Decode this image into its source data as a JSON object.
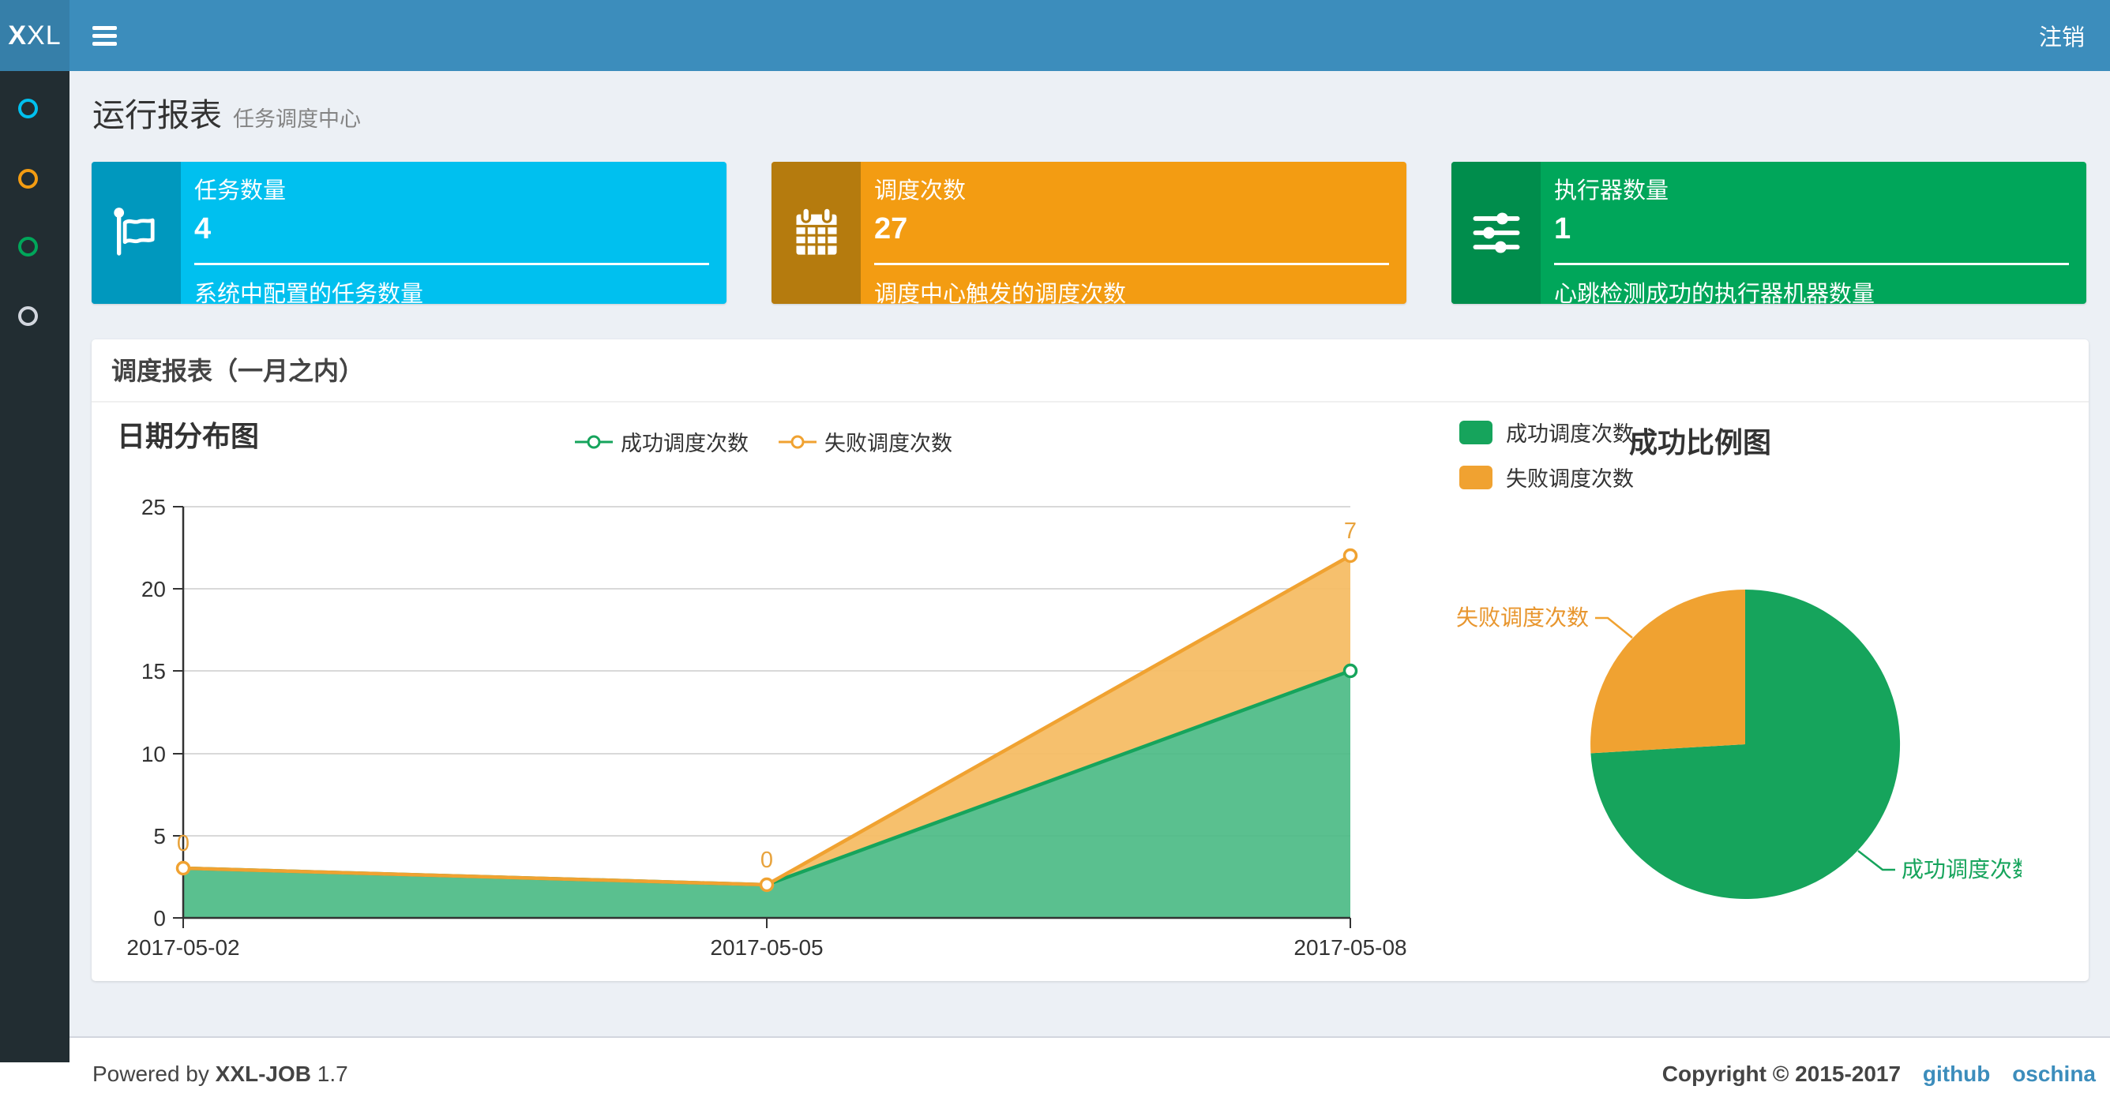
{
  "navbar": {
    "logo_bold": "X",
    "logo_rest": "XL",
    "logout_label": "注销"
  },
  "sidebar": {
    "items": [
      {
        "name": "running-report",
        "color": "#00c0ef"
      },
      {
        "name": "job-manage",
        "color": "#f39c12"
      },
      {
        "name": "executor-manage",
        "color": "#00a65a"
      },
      {
        "name": "help",
        "color": "#d2d6de"
      }
    ]
  },
  "page_header": {
    "title": "运行报表",
    "subtitle": "任务调度中心"
  },
  "info_boxes": [
    {
      "title": "任务数量",
      "value": "4",
      "description": "系统中配置的任务数量",
      "icon": "flag-icon",
      "color": "#00c0ef"
    },
    {
      "title": "调度次数",
      "value": "27",
      "description": "调度中心触发的调度次数",
      "icon": "calendar-icon",
      "color": "#f39c12"
    },
    {
      "title": "执行器数量",
      "value": "1",
      "description": "心跳检测成功的执行器机器数量",
      "icon": "sliders-icon",
      "color": "#00a65a"
    }
  ],
  "panel": {
    "title": "调度报表（一月之内）"
  },
  "line_chart": {
    "title": "日期分布图",
    "legend": [
      {
        "label": "成功调度次数",
        "color": "#16a45c"
      },
      {
        "label": "失败调度次数",
        "color": "#f0a231"
      }
    ],
    "y_ticks": [
      "25",
      "20",
      "15",
      "10",
      "5",
      "0"
    ],
    "x_labels": [
      "2017-05-02",
      "2017-05-05",
      "2017-05-08"
    ],
    "point_labels": [
      "0",
      "0",
      "7"
    ]
  },
  "pie_chart": {
    "title": "成功比例图",
    "legend": [
      {
        "label": "成功调度次数",
        "color": "#16a45c"
      },
      {
        "label": "失败调度次数",
        "color": "#f0a231"
      }
    ],
    "callout_fail": "失败调度次数",
    "callout_success": "成功调度次数"
  },
  "chart_data": [
    {
      "type": "area",
      "title": "日期分布图",
      "x": [
        "2017-05-02",
        "2017-05-05",
        "2017-05-08"
      ],
      "series": [
        {
          "name": "成功调度次数",
          "values": [
            3,
            2,
            15
          ],
          "color": "#16a45c"
        },
        {
          "name": "失败调度次数",
          "values": [
            0,
            0,
            7
          ],
          "color": "#f0a231"
        }
      ],
      "stacked": true,
      "ylim": [
        0,
        25
      ],
      "y_tick_step": 5,
      "grid": true,
      "legend_position": "top-center",
      "data_labels_failure": [
        0,
        0,
        7
      ]
    },
    {
      "type": "pie",
      "title": "成功比例图",
      "slices": [
        {
          "name": "成功调度次数",
          "value": 20,
          "color": "#16a45c"
        },
        {
          "name": "失败调度次数",
          "value": 7,
          "color": "#f0a231"
        }
      ],
      "legend_position": "top-left"
    }
  ],
  "footer": {
    "powered_prefix": "Powered by ",
    "brand": "XXL-JOB",
    "version": "1.7",
    "copyright": "Copyright © 2015-2017",
    "links": [
      {
        "label": "github"
      },
      {
        "label": "oschina"
      }
    ]
  },
  "colors": {
    "navbar": "#3c8dbc",
    "logo_bg": "#367fa9",
    "sidebar": "#222d32",
    "content_bg": "#ecf0f5",
    "aqua": "#00c0ef",
    "yellow": "#f39c12",
    "green": "#00a65a",
    "chart_green": "#16a45c",
    "chart_orange": "#f0a231",
    "area_green_fill": "#4cbb85",
    "area_orange_fill": "#f5bd65",
    "link": "#3c8dbc"
  }
}
